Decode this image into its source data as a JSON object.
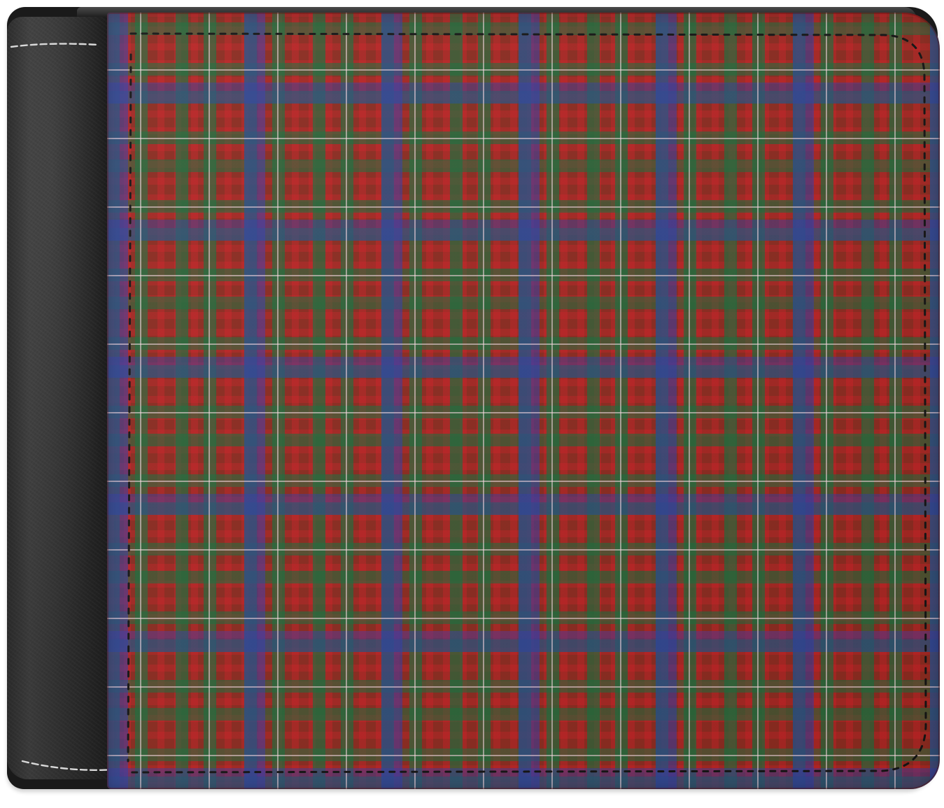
{
  "scene": {
    "subject": "bifold-wallet",
    "spine_color": "#2c2c2c",
    "spine_stitch_color": "#d9d9d9",
    "panel_pattern": "tartan-plaid",
    "plaid_colors": {
      "base_red": "#8a2a1f",
      "bright_red": "#dc1e28",
      "green": "#196e3c",
      "blue": "#323caa",
      "pinstripe": "#ffdce6"
    },
    "panel_stitch_color": "#141414",
    "background": "#ffffff"
  }
}
